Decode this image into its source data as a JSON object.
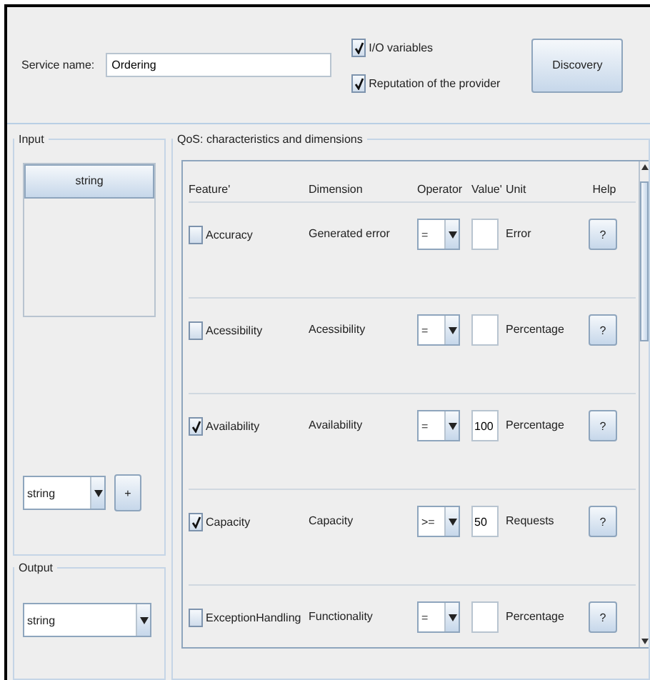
{
  "service": {
    "label": "Service name:",
    "value": "Ordering"
  },
  "options": [
    {
      "label": "I/O variables",
      "checked": true
    },
    {
      "label": "Reputation of the provider",
      "checked": true
    }
  ],
  "discovery_button": "Discovery",
  "input": {
    "title": "Input",
    "items": [
      {
        "label": "string",
        "selected": true
      }
    ],
    "type_combo": "string",
    "add_button": "+"
  },
  "output": {
    "title": "Output",
    "type_combo": "string"
  },
  "qos": {
    "title": "QoS: characteristics and dimensions",
    "columns": [
      "Feature'",
      "Dimension",
      "Operator",
      "Value'",
      "Unit",
      "Help"
    ],
    "rows": [
      {
        "feature": "Accuracy",
        "checked": false,
        "dimension": "Generated error",
        "operator": "=",
        "value": "",
        "unit": "Error",
        "help": "?"
      },
      {
        "feature": "Acessibility",
        "checked": false,
        "dimension": "Acessibility",
        "operator": "=",
        "value": "",
        "unit": "Percentage",
        "help": "?"
      },
      {
        "feature": "Availability",
        "checked": true,
        "dimension": "Availability",
        "operator": "=",
        "value": "100",
        "unit": "Percentage",
        "help": "?"
      },
      {
        "feature": "Capacity",
        "checked": true,
        "dimension": "Capacity",
        "operator": ">=",
        "value": "50",
        "unit": "Requests",
        "help": "?"
      },
      {
        "feature": "ExceptionHandling",
        "checked": false,
        "dimension": "Functionality",
        "operator": "=",
        "value": "",
        "unit": "Percentage",
        "help": "?"
      }
    ]
  }
}
